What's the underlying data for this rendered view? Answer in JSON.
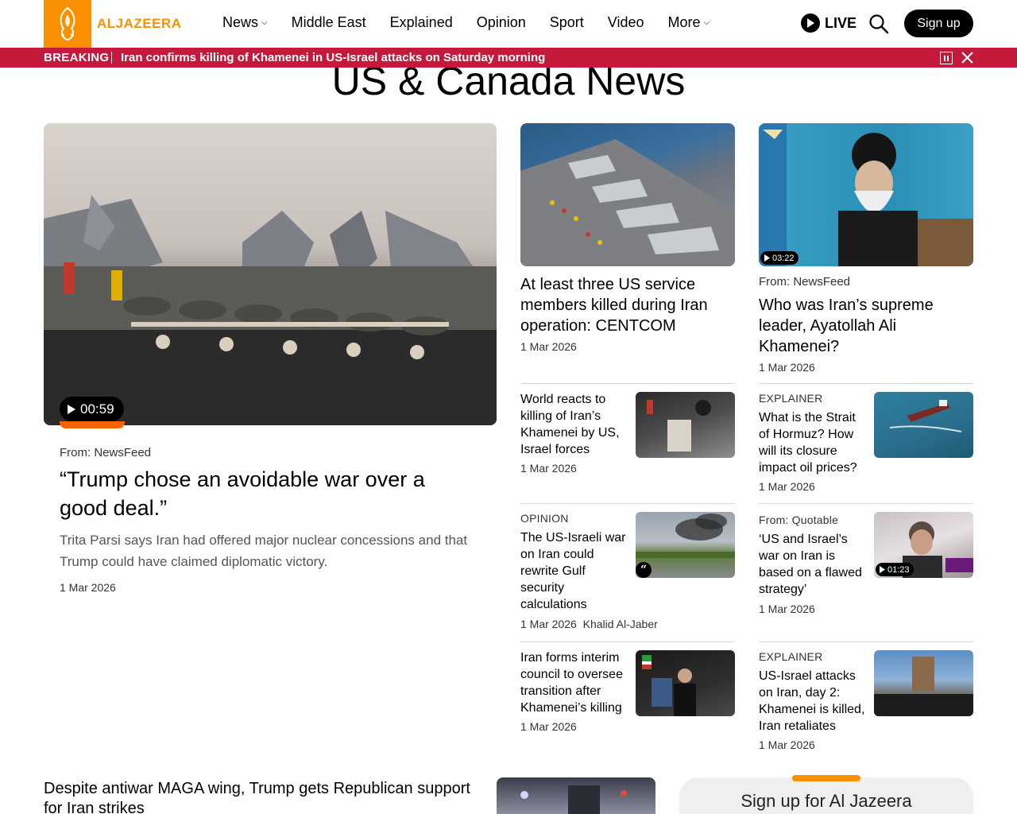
{
  "header": {
    "logo_text": "ALJAZEERA",
    "nav": [
      {
        "label": "News",
        "dropdown": true
      },
      {
        "label": "Middle East",
        "dropdown": false
      },
      {
        "label": "Explained",
        "dropdown": false
      },
      {
        "label": "Opinion",
        "dropdown": false
      },
      {
        "label": "Sport",
        "dropdown": false
      },
      {
        "label": "Video",
        "dropdown": false
      },
      {
        "label": "More",
        "dropdown": true
      }
    ],
    "live_label": "LIVE",
    "signup_label": "Sign up"
  },
  "breaking": {
    "label": "BREAKING",
    "text": "Iran confirms killing of Khamenei in US-Israel attacks on Saturday morning"
  },
  "page_title": "US & Canada News",
  "hero": {
    "video_duration": "00:59",
    "from": "From: NewsFeed",
    "title": "“Trump chose an avoidable war over a good deal.”",
    "description": "Trita Parsi says Iran had offered major nuclear concessions and that Trump could have claimed diplomatic victory.",
    "date": "1 Mar 2026"
  },
  "column_middle": {
    "top": {
      "title": "At least three US service members killed during Iran operation: CENTCOM",
      "date": "1 Mar 2026"
    },
    "items": [
      {
        "kicker": "",
        "title": "World reacts to killing of Iran’s Khamenei by US, Israel forces",
        "date": "1 Mar 2026",
        "author": ""
      },
      {
        "kicker": "OPINION",
        "title": "The US-Israeli war on Iran could rewrite Gulf security calculations",
        "date": "1 Mar 2026",
        "author": "Khalid Al-Jaber"
      },
      {
        "kicker": "",
        "title": "Iran forms interim council to oversee transition after Khamenei’s killing",
        "date": "1 Mar 2026",
        "author": ""
      }
    ]
  },
  "column_right": {
    "top": {
      "video_duration": "03:22",
      "from": "From: NewsFeed",
      "title": "Who was Iran’s supreme leader, Ayatollah Ali Khamenei?",
      "date": "1 Mar 2026"
    },
    "items": [
      {
        "kicker": "EXPLAINER",
        "title": "What is the Strait of Hormuz? How will its closure impact oil prices?",
        "date": "1 Mar 2026",
        "video_duration": ""
      },
      {
        "kicker": "From: Quotable",
        "title": "‘US and Israel’s war on Iran is based on a flawed strategy’",
        "date": "1 Mar 2026",
        "video_duration": "01:23"
      },
      {
        "kicker": "EXPLAINER",
        "title": "US-Israel attacks on Iran, day 2: Khamenei is killed, Iran retaliates",
        "date": "1 Mar 2026",
        "video_duration": ""
      }
    ]
  },
  "bottom": {
    "title": "Despite antiwar MAGA wing, Trump gets Republican support for Iran strikes",
    "newsletter_title": "Sign up for Al Jazeera"
  },
  "colors": {
    "brand": "#fa9000",
    "breaking": "#c4193a",
    "video_progress": "#fa6400"
  },
  "icons": [
    "logo-emblem-icon",
    "chevron-down-icon",
    "play-icon",
    "search-icon",
    "pause-icon",
    "close-icon",
    "quote-icon"
  ]
}
